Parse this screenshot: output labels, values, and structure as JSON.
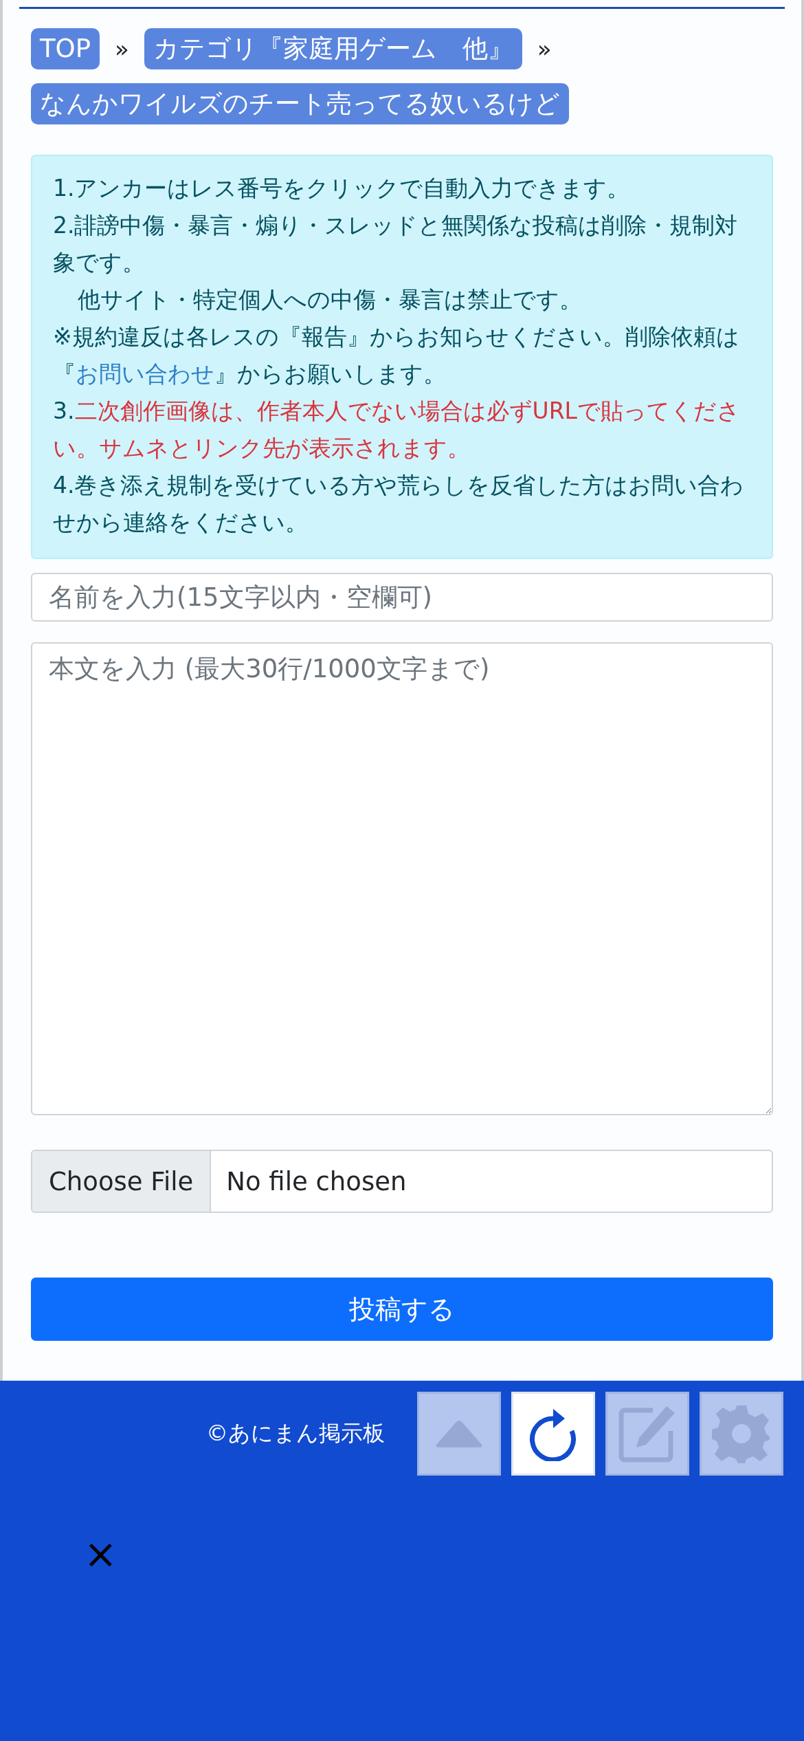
{
  "breadcrumb": [
    {
      "label": "TOP"
    },
    {
      "label": "カテゴリ『家庭用ゲーム　他』"
    },
    {
      "label": "なんかワイルズのチート売ってる奴いるけど"
    }
  ],
  "breadcrumb_separator": "»",
  "notice": [
    {
      "parts": [
        {
          "text": "1.アンカーはレス番号をクリックで自動入力できます。",
          "kind": "normal"
        }
      ]
    },
    {
      "parts": [
        {
          "text": "2.誹謗中傷・暴言・煽り・スレッドと無関係な投稿は削除・規制対象です。",
          "kind": "normal"
        }
      ]
    },
    {
      "indent": true,
      "parts": [
        {
          "text": "他サイト・特定個人への中傷・暴言は禁止です。",
          "kind": "normal"
        }
      ]
    },
    {
      "parts": [
        {
          "text": "※規約違反は各レスの『報告』からお知らせください。削除依頼は『",
          "kind": "normal"
        },
        {
          "text": "お問い合わせ",
          "kind": "link"
        },
        {
          "text": "』からお願いします。",
          "kind": "normal"
        }
      ]
    },
    {
      "parts": [
        {
          "text": "3.",
          "kind": "normal"
        },
        {
          "text": "二次創作画像は、作者本人でない場合は必ずURLで貼ってください。サムネとリンク先が表示されます。",
          "kind": "warning"
        }
      ]
    },
    {
      "parts": [
        {
          "text": "4.巻き添え規制を受けている方や荒らしを反省した方はお問い合わせから連絡をください。",
          "kind": "normal"
        }
      ]
    }
  ],
  "name_field": {
    "placeholder": "名前を入力(15文字以内・空欄可)"
  },
  "body_field": {
    "placeholder": "本文を入力 (最大30行/1000文字まで)"
  },
  "file_input": {
    "button": "Choose File",
    "status": "No file chosen"
  },
  "submit_button": "投稿する",
  "footer": {
    "copyright": "©あにまん掲示板",
    "close": "×"
  },
  "floating_buttons": [
    {
      "kind": "up",
      "disabled": true
    },
    {
      "kind": "refresh",
      "disabled": false
    },
    {
      "kind": "edit",
      "disabled": true
    },
    {
      "kind": "settings",
      "disabled": true
    }
  ]
}
